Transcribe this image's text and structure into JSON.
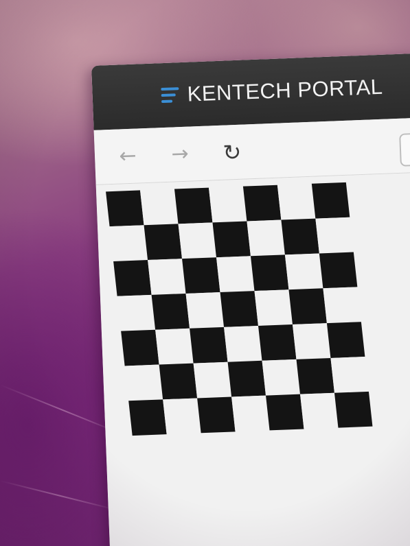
{
  "window": {
    "title": "KENTECH PORTAL",
    "menu_icon": "hamburger-menu-icon"
  },
  "toolbar": {
    "back_glyph": "←",
    "forward_glyph": "→",
    "reload_glyph": "↻",
    "back_icon": "back-arrow-icon",
    "forward_icon": "forward-arrow-icon",
    "reload_icon": "reload-icon"
  },
  "content": {
    "checkerboard": {
      "rows": 7,
      "cols": 7,
      "dark_color": "#141414",
      "light_color": "#f1f1f1"
    }
  },
  "colors": {
    "titlebar": "#2b2b2b",
    "accent": "#3b8fd6",
    "wallpaper": "#7a2a78"
  }
}
